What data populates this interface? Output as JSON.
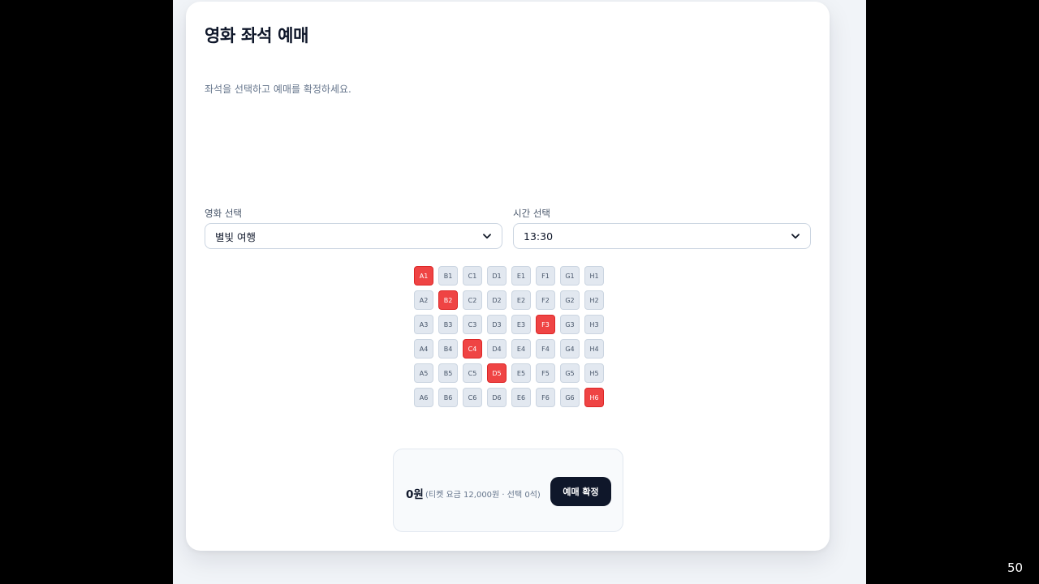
{
  "page": {
    "title": "영화 좌석 예매",
    "subtitle": "좌석을 선택하고 예매를 확정하세요."
  },
  "movie_select": {
    "label": "영화 선택",
    "value": "별빛 여행"
  },
  "time_select": {
    "label": "시간 선택",
    "value": "13:30"
  },
  "seats": {
    "rows": [
      [
        {
          "id": "A1",
          "taken": true
        },
        {
          "id": "B1",
          "taken": false
        },
        {
          "id": "C1",
          "taken": false
        },
        {
          "id": "D1",
          "taken": false
        },
        {
          "id": "E1",
          "taken": false
        },
        {
          "id": "F1",
          "taken": false
        },
        {
          "id": "G1",
          "taken": false
        },
        {
          "id": "H1",
          "taken": false
        }
      ],
      [
        {
          "id": "A2",
          "taken": false
        },
        {
          "id": "B2",
          "taken": true
        },
        {
          "id": "C2",
          "taken": false
        },
        {
          "id": "D2",
          "taken": false
        },
        {
          "id": "E2",
          "taken": false
        },
        {
          "id": "F2",
          "taken": false
        },
        {
          "id": "G2",
          "taken": false
        },
        {
          "id": "H2",
          "taken": false
        }
      ],
      [
        {
          "id": "A3",
          "taken": false
        },
        {
          "id": "B3",
          "taken": false
        },
        {
          "id": "C3",
          "taken": false
        },
        {
          "id": "D3",
          "taken": false
        },
        {
          "id": "E3",
          "taken": false
        },
        {
          "id": "F3",
          "taken": true
        },
        {
          "id": "G3",
          "taken": false
        },
        {
          "id": "H3",
          "taken": false
        }
      ],
      [
        {
          "id": "A4",
          "taken": false
        },
        {
          "id": "B4",
          "taken": false
        },
        {
          "id": "C4",
          "taken": true
        },
        {
          "id": "D4",
          "taken": false
        },
        {
          "id": "E4",
          "taken": false
        },
        {
          "id": "F4",
          "taken": false
        },
        {
          "id": "G4",
          "taken": false
        },
        {
          "id": "H4",
          "taken": false
        }
      ],
      [
        {
          "id": "A5",
          "taken": false
        },
        {
          "id": "B5",
          "taken": false
        },
        {
          "id": "C5",
          "taken": false
        },
        {
          "id": "D5",
          "taken": true
        },
        {
          "id": "E5",
          "taken": false
        },
        {
          "id": "F5",
          "taken": false
        },
        {
          "id": "G5",
          "taken": false
        },
        {
          "id": "H5",
          "taken": false
        }
      ],
      [
        {
          "id": "A6",
          "taken": false
        },
        {
          "id": "B6",
          "taken": false
        },
        {
          "id": "C6",
          "taken": false
        },
        {
          "id": "D6",
          "taken": false
        },
        {
          "id": "E6",
          "taken": false
        },
        {
          "id": "F6",
          "taken": false
        },
        {
          "id": "G6",
          "taken": false
        },
        {
          "id": "H6",
          "taken": true
        }
      ]
    ]
  },
  "summary": {
    "price": "0원",
    "detail": "(티켓 요금 12,000원 · 선택 0석)",
    "confirm_label": "예매 확정"
  },
  "slide": {
    "number": "50"
  },
  "colors": {
    "taken_seat": "#ef4444",
    "available_seat": "#e2e8f0",
    "primary_button": "#0f172a"
  },
  "icons": {
    "select_arrow": "chevron-down-icon"
  }
}
